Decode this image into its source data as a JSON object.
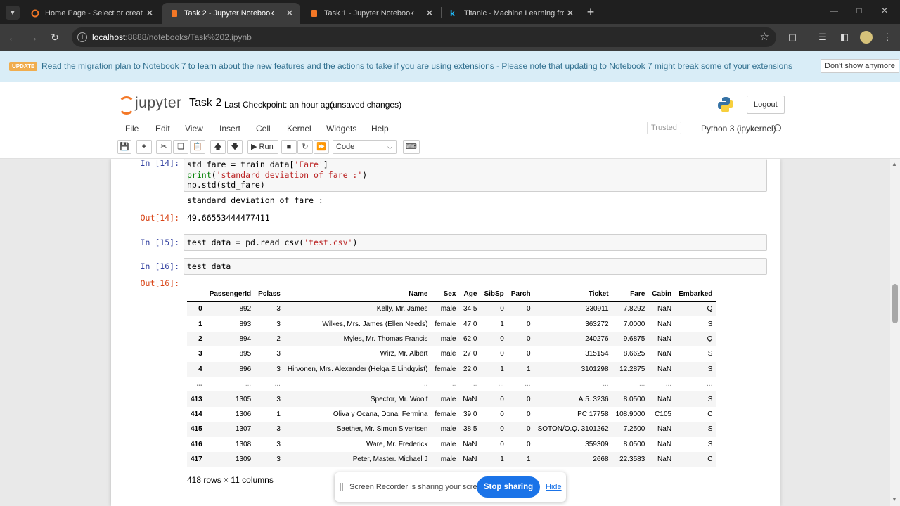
{
  "browser": {
    "tabs": [
      {
        "title": "Home Page - Select or create a notebook",
        "active": false
      },
      {
        "title": "Task 2 - Jupyter Notebook",
        "active": true
      },
      {
        "title": "Task 1 - Jupyter Notebook",
        "active": false
      },
      {
        "title": "Titanic - Machine Learning from Disaster",
        "active": false
      }
    ],
    "url_host": "localhost",
    "url_path": ":8888/notebooks/Task%202.ipynb"
  },
  "banner": {
    "badge": "UPDATE",
    "msg_pre": "Read ",
    "msg_link": "the migration plan",
    "msg_post": " to Notebook 7 to learn about the new features and the actions to take if you are using extensions - Please note that updating to Notebook 7 might break some of your extensions",
    "dismiss": "Don't show anymore"
  },
  "header": {
    "logo_text": "jupyter",
    "notebook_name": "Task 2",
    "checkpoint": "Last Checkpoint: an hour ago",
    "autosave": "(unsaved changes)",
    "logout": "Logout"
  },
  "menu": [
    "File",
    "Edit",
    "View",
    "Insert",
    "Cell",
    "Kernel",
    "Widgets",
    "Help"
  ],
  "status": {
    "trusted": "Trusted",
    "kernel": "Python 3 (ipykernel)"
  },
  "toolbar": {
    "run": "Run",
    "cell_type": "Code"
  },
  "cells": {
    "c14": {
      "prompt_in": "In [14]:",
      "prompt_out": "Out[14]:",
      "stdout": "standard deviation of fare :",
      "result": "49.66553444477411"
    },
    "c15": {
      "prompt_in": "In [15]:"
    },
    "c16": {
      "prompt_in": "In [16]:",
      "prompt_out": "Out[16]:"
    }
  },
  "dataframe": {
    "columns": [
      "",
      "PassengerId",
      "Pclass",
      "Name",
      "Sex",
      "Age",
      "SibSp",
      "Parch",
      "Ticket",
      "Fare",
      "Cabin",
      "Embarked"
    ],
    "rows": [
      [
        "0",
        "892",
        "3",
        "Kelly, Mr. James",
        "male",
        "34.5",
        "0",
        "0",
        "330911",
        "7.8292",
        "NaN",
        "Q"
      ],
      [
        "1",
        "893",
        "3",
        "Wilkes, Mrs. James (Ellen Needs)",
        "female",
        "47.0",
        "1",
        "0",
        "363272",
        "7.0000",
        "NaN",
        "S"
      ],
      [
        "2",
        "894",
        "2",
        "Myles, Mr. Thomas Francis",
        "male",
        "62.0",
        "0",
        "0",
        "240276",
        "9.6875",
        "NaN",
        "Q"
      ],
      [
        "3",
        "895",
        "3",
        "Wirz, Mr. Albert",
        "male",
        "27.0",
        "0",
        "0",
        "315154",
        "8.6625",
        "NaN",
        "S"
      ],
      [
        "4",
        "896",
        "3",
        "Hirvonen, Mrs. Alexander (Helga E Lindqvist)",
        "female",
        "22.0",
        "1",
        "1",
        "3101298",
        "12.2875",
        "NaN",
        "S"
      ],
      [
        "...",
        "...",
        "...",
        "...",
        "...",
        "...",
        "...",
        "...",
        "...",
        "...",
        "...",
        "..."
      ],
      [
        "413",
        "1305",
        "3",
        "Spector, Mr. Woolf",
        "male",
        "NaN",
        "0",
        "0",
        "A.5. 3236",
        "8.0500",
        "NaN",
        "S"
      ],
      [
        "414",
        "1306",
        "1",
        "Oliva y Ocana, Dona. Fermina",
        "female",
        "39.0",
        "0",
        "0",
        "PC 17758",
        "108.9000",
        "C105",
        "C"
      ],
      [
        "415",
        "1307",
        "3",
        "Saether, Mr. Simon Sivertsen",
        "male",
        "38.5",
        "0",
        "0",
        "SOTON/O.Q. 3101262",
        "7.2500",
        "NaN",
        "S"
      ],
      [
        "416",
        "1308",
        "3",
        "Ware, Mr. Frederick",
        "male",
        "NaN",
        "0",
        "0",
        "359309",
        "8.0500",
        "NaN",
        "S"
      ],
      [
        "417",
        "1309",
        "3",
        "Peter, Master. Michael J",
        "male",
        "NaN",
        "1",
        "1",
        "2668",
        "22.3583",
        "NaN",
        "C"
      ]
    ],
    "shape": "418 rows × 11 columns"
  },
  "recorder": {
    "message": "Screen Recorder is sharing your screen.",
    "stop": "Stop sharing",
    "hide": "Hide"
  },
  "colors": {
    "accent": "#f37726",
    "prompt_in": "#303f9f",
    "prompt_out": "#d84315",
    "stop_button": "#1a73e8"
  }
}
